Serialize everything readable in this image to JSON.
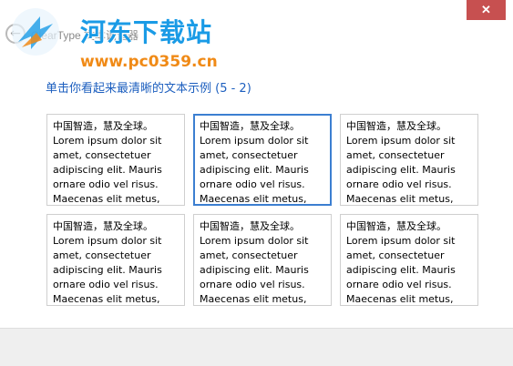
{
  "window": {
    "title": "ClearType 文本调谐器",
    "close_glyph": "✕"
  },
  "watermark": {
    "site_name": "河东下载站",
    "url": "www.pc0359.cn"
  },
  "heading": "单击你看起来最清晰的文本示例 (5 - 2)",
  "samples": [
    {
      "cn": "中国智造，慧及全球。",
      "lorem": "Lorem ipsum dolor sit amet, consectetuer adipiscing elit. Mauris ornare odio vel risus. Maecenas elit metus,",
      "selected": false
    },
    {
      "cn": "中国智造，慧及全球。",
      "lorem": "Lorem ipsum dolor sit amet, consectetuer adipiscing elit. Mauris ornare odio vel risus. Maecenas elit metus,",
      "selected": true
    },
    {
      "cn": "中国智造，慧及全球。",
      "lorem": "Lorem ipsum dolor sit amet, consectetuer adipiscing elit. Mauris ornare odio vel risus. Maecenas elit metus,",
      "selected": false
    },
    {
      "cn": "中国智造，慧及全球。",
      "lorem": "Lorem ipsum dolor sit amet, consectetuer adipiscing elit. Mauris ornare odio vel risus. Maecenas elit metus,",
      "selected": false
    },
    {
      "cn": "中国智造，慧及全球。",
      "lorem": "Lorem ipsum dolor sit amet, consectetuer adipiscing elit. Mauris ornare odio vel risus. Maecenas elit metus,",
      "selected": false
    },
    {
      "cn": "中国智造，慧及全球。",
      "lorem": "Lorem ipsum dolor sit amet, consectetuer adipiscing elit. Mauris ornare odio vel risus. Maecenas elit metus,",
      "selected": false
    }
  ],
  "colors": {
    "accent": "#3c7fd1",
    "heading": "#1d5fbf",
    "close_button": "#c75050"
  }
}
